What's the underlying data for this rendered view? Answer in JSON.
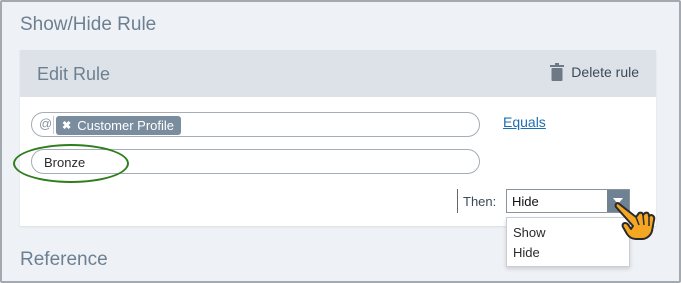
{
  "section_title": "Show/Hide Rule",
  "edit_rule": {
    "title": "Edit Rule",
    "delete_label": "Delete rule"
  },
  "condition": {
    "at_symbol": "@",
    "field_tag": "Customer Profile",
    "operator": "Equals",
    "value": "Bronze"
  },
  "then": {
    "label": "Then:",
    "selected": "Hide",
    "options": [
      "Show",
      "Hide"
    ]
  },
  "reference_title": "Reference",
  "colors": {
    "accent": "#1f6fb0",
    "highlight": "#2f7d1e",
    "cursor": "#f5a623"
  },
  "icons": [
    "trash-icon",
    "remove-tag-icon",
    "chevron-down-icon",
    "pointer-hand-icon"
  ]
}
